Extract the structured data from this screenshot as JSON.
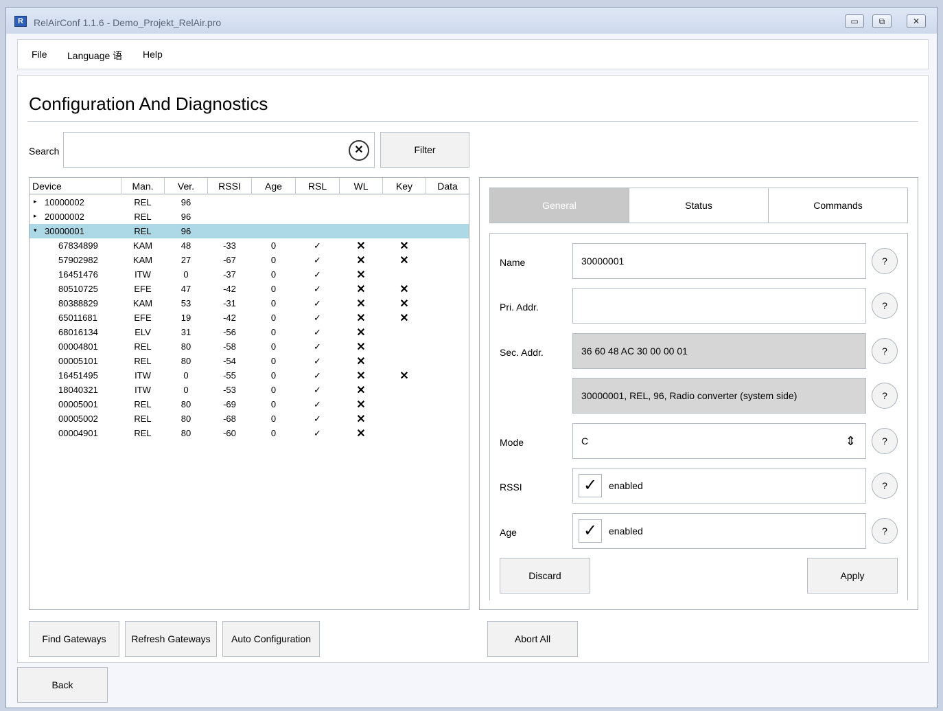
{
  "window": {
    "icon": "R",
    "title": "RelAirConf 1.1.6 - Demo_Projekt_RelAir.pro",
    "controls": {
      "minimize": "▭",
      "maximize": "⧉",
      "close": "✕"
    }
  },
  "menu": {
    "file": "File",
    "language": "Language 语",
    "help": "Help"
  },
  "page": {
    "title": "Configuration And Diagnostics"
  },
  "search": {
    "label": "Search",
    "value": "",
    "clear": "✕",
    "filter": "Filter"
  },
  "tree": {
    "columns": [
      "Device",
      "Man.",
      "Ver.",
      "RSSI",
      "Age",
      "RSL",
      "WL",
      "Key",
      "Data"
    ],
    "rows": [
      {
        "arrow": "▸",
        "device": "10000002",
        "man": "REL",
        "ver": "96",
        "rssi": "",
        "age": "",
        "rsl": "",
        "wl": "",
        "key": "",
        "data": ""
      },
      {
        "arrow": "▸",
        "device": "20000002",
        "man": "REL",
        "ver": "96",
        "rssi": "",
        "age": "",
        "rsl": "",
        "wl": "",
        "key": "",
        "data": ""
      },
      {
        "arrow": "▾",
        "device": "30000001",
        "man": "REL",
        "ver": "96",
        "rssi": "",
        "age": "",
        "rsl": "",
        "wl": "",
        "key": "",
        "data": ""
      },
      {
        "arrow": "",
        "device": "67834899",
        "man": "KAM",
        "ver": "48",
        "rssi": "-33",
        "age": "0",
        "rsl": "✓",
        "wl": "✕",
        "key": "✕",
        "data": ""
      },
      {
        "arrow": "",
        "device": "57902982",
        "man": "KAM",
        "ver": "27",
        "rssi": "-67",
        "age": "0",
        "rsl": "✓",
        "wl": "✕",
        "key": "✕",
        "data": ""
      },
      {
        "arrow": "",
        "device": "16451476",
        "man": "ITW",
        "ver": "0",
        "rssi": "-37",
        "age": "0",
        "rsl": "✓",
        "wl": "✕",
        "key": "",
        "data": ""
      },
      {
        "arrow": "",
        "device": "80510725",
        "man": "EFE",
        "ver": "47",
        "rssi": "-42",
        "age": "0",
        "rsl": "✓",
        "wl": "✕",
        "key": "✕",
        "data": ""
      },
      {
        "arrow": "",
        "device": "80388829",
        "man": "KAM",
        "ver": "53",
        "rssi": "-31",
        "age": "0",
        "rsl": "✓",
        "wl": "✕",
        "key": "✕",
        "data": ""
      },
      {
        "arrow": "",
        "device": "65011681",
        "man": "EFE",
        "ver": "19",
        "rssi": "-42",
        "age": "0",
        "rsl": "✓",
        "wl": "✕",
        "key": "✕",
        "data": ""
      },
      {
        "arrow": "",
        "device": "68016134",
        "man": "ELV",
        "ver": "31",
        "rssi": "-56",
        "age": "0",
        "rsl": "✓",
        "wl": "✕",
        "key": "",
        "data": ""
      },
      {
        "arrow": "",
        "device": "00004801",
        "man": "REL",
        "ver": "80",
        "rssi": "-58",
        "age": "0",
        "rsl": "✓",
        "wl": "✕",
        "key": "",
        "data": ""
      },
      {
        "arrow": "",
        "device": "00005101",
        "man": "REL",
        "ver": "80",
        "rssi": "-54",
        "age": "0",
        "rsl": "✓",
        "wl": "✕",
        "key": "",
        "data": ""
      },
      {
        "arrow": "",
        "device": "16451495",
        "man": "ITW",
        "ver": "0",
        "rssi": "-55",
        "age": "0",
        "rsl": "✓",
        "wl": "✕",
        "key": "✕",
        "data": ""
      },
      {
        "arrow": "",
        "device": "18040321",
        "man": "ITW",
        "ver": "0",
        "rssi": "-53",
        "age": "0",
        "rsl": "✓",
        "wl": "✕",
        "key": "",
        "data": ""
      },
      {
        "arrow": "",
        "device": "00005001",
        "man": "REL",
        "ver": "80",
        "rssi": "-69",
        "age": "0",
        "rsl": "✓",
        "wl": "✕",
        "key": "",
        "data": ""
      },
      {
        "arrow": "",
        "device": "00005002",
        "man": "REL",
        "ver": "80",
        "rssi": "-68",
        "age": "0",
        "rsl": "✓",
        "wl": "✕",
        "key": "",
        "data": ""
      },
      {
        "arrow": "",
        "device": "00004901",
        "man": "REL",
        "ver": "80",
        "rssi": "-60",
        "age": "0",
        "rsl": "✓",
        "wl": "✕",
        "key": "",
        "data": ""
      }
    ]
  },
  "tabs": {
    "general": "General",
    "status": "Status",
    "commands": "Commands"
  },
  "form": {
    "name_label": "Name",
    "name_value": "30000001",
    "pri_label": "Pri. Addr.",
    "pri_value": "",
    "sec_label": "Sec. Addr.",
    "sec_value": "36 60 48 AC 30 00 00 01",
    "desc_value": "30000001, REL, 96, Radio converter (system side)",
    "mode_label": "Mode",
    "mode_value": "C",
    "mode_spin": "⇕",
    "rssi_label": "RSSI",
    "rssi_check": "✓",
    "rssi_text": "enabled",
    "age_label": "Age",
    "age_check": "✓",
    "age_text": "enabled",
    "help": "?",
    "discard": "Discard",
    "apply": "Apply"
  },
  "bottom": {
    "find_gateways": "Find Gateways",
    "refresh_gateways": "Refresh Gateways",
    "auto_configuration": "Auto Configuration",
    "abort_all": "Abort All",
    "back": "Back"
  },
  "colors": {
    "selected_row": "#add8e6",
    "active_tab": "#c8c8c8",
    "readonly_field": "#d6d6d6"
  }
}
